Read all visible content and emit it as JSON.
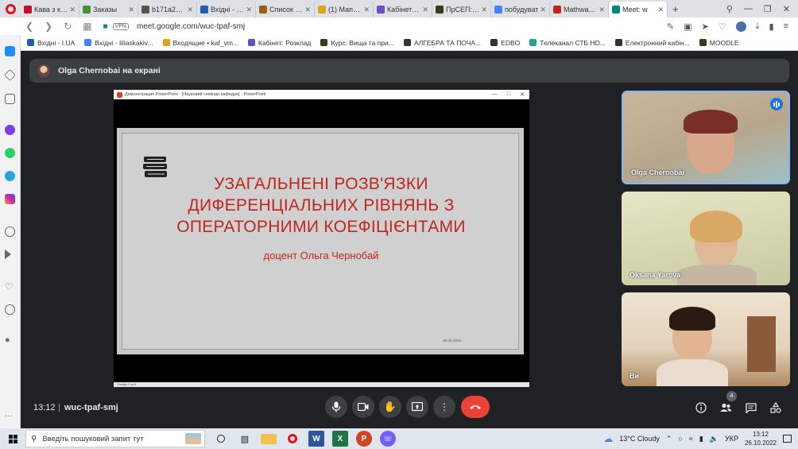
{
  "browser": {
    "tabs": [
      {
        "label": "Кава з кар",
        "color": "#c8102e"
      },
      {
        "label": "Заказы",
        "color": "#4a8f3a"
      },
      {
        "label": "b171a2b0d",
        "color": "#555555"
      },
      {
        "label": "Вхідні - I.UA",
        "color": "#1f5fb0"
      },
      {
        "label": "Список зан",
        "color": "#a05a1a"
      },
      {
        "label": "(1) Мапа тр",
        "color": "#e0a020"
      },
      {
        "label": "Кабінет: Ро",
        "color": "#6a4fc1"
      },
      {
        "label": "ПрСЕП: Уча",
        "color": "#3a3a1a"
      },
      {
        "label": "побудуват",
        "color": "#4285f4"
      },
      {
        "label": "Mathway | С",
        "color": "#c0261c"
      },
      {
        "label": "Meet: w",
        "color": "#00897b"
      }
    ],
    "new_tab": "+",
    "url": "meet.google.com/wuc-tpaf-smj",
    "vpn": "VPN",
    "bookmarks": [
      {
        "label": "Вхідні - I.UA",
        "color": "#1f5fb0"
      },
      {
        "label": "Вхідні - liliaskakiv...",
        "color": "#4285f4"
      },
      {
        "label": "Входящие • kaf_vm...",
        "color": "#e0a020"
      },
      {
        "label": "Кабінет: Розклад",
        "color": "#6a4fc1"
      },
      {
        "label": "Курс: Вища та при...",
        "color": "#3a3a1a"
      },
      {
        "label": "АЛГЕБРА ТА ПОЧА...",
        "color": "#333333"
      },
      {
        "label": "EDBO",
        "color": "#333333"
      },
      {
        "label": "Телеканал СТБ HD...",
        "color": "#2aa198"
      },
      {
        "label": "Електронний кабін...",
        "color": "#333333"
      },
      {
        "label": "MOODLE",
        "color": "#3a3a1a"
      }
    ]
  },
  "meet": {
    "presenter_banner": "Olga Chernobai на екрані",
    "shared_window_title": "Демонстрация PowerPoint - [Науковий семінар кафедри] - PowerPoint",
    "slide": {
      "title": "УЗАГАЛЬНЕНІ РОЗВ'ЯЗКИ ДИФЕРЕНЦІАЛЬНИХ РІВНЯНЬ З ОПЕРАТОРНИМИ КОЕФІЦІЄНТАМИ",
      "author": "доцент Ольга Чернобай",
      "date": "26.10.2022"
    },
    "slide_counter": "Слайд 1 из 8",
    "participants": [
      {
        "name": "Olga Chernobai"
      },
      {
        "name": "Oksana Yarova"
      },
      {
        "name": "Ви"
      }
    ],
    "time": "13:12",
    "meeting_code": "wuc-tpaf-smj",
    "people_count": "4"
  },
  "taskbar": {
    "search_placeholder": "Введіть пошуковий запит тут",
    "weather": "13°C  Cloudy",
    "language": "УКР",
    "time": "13:12",
    "date": "26.10.2022"
  }
}
